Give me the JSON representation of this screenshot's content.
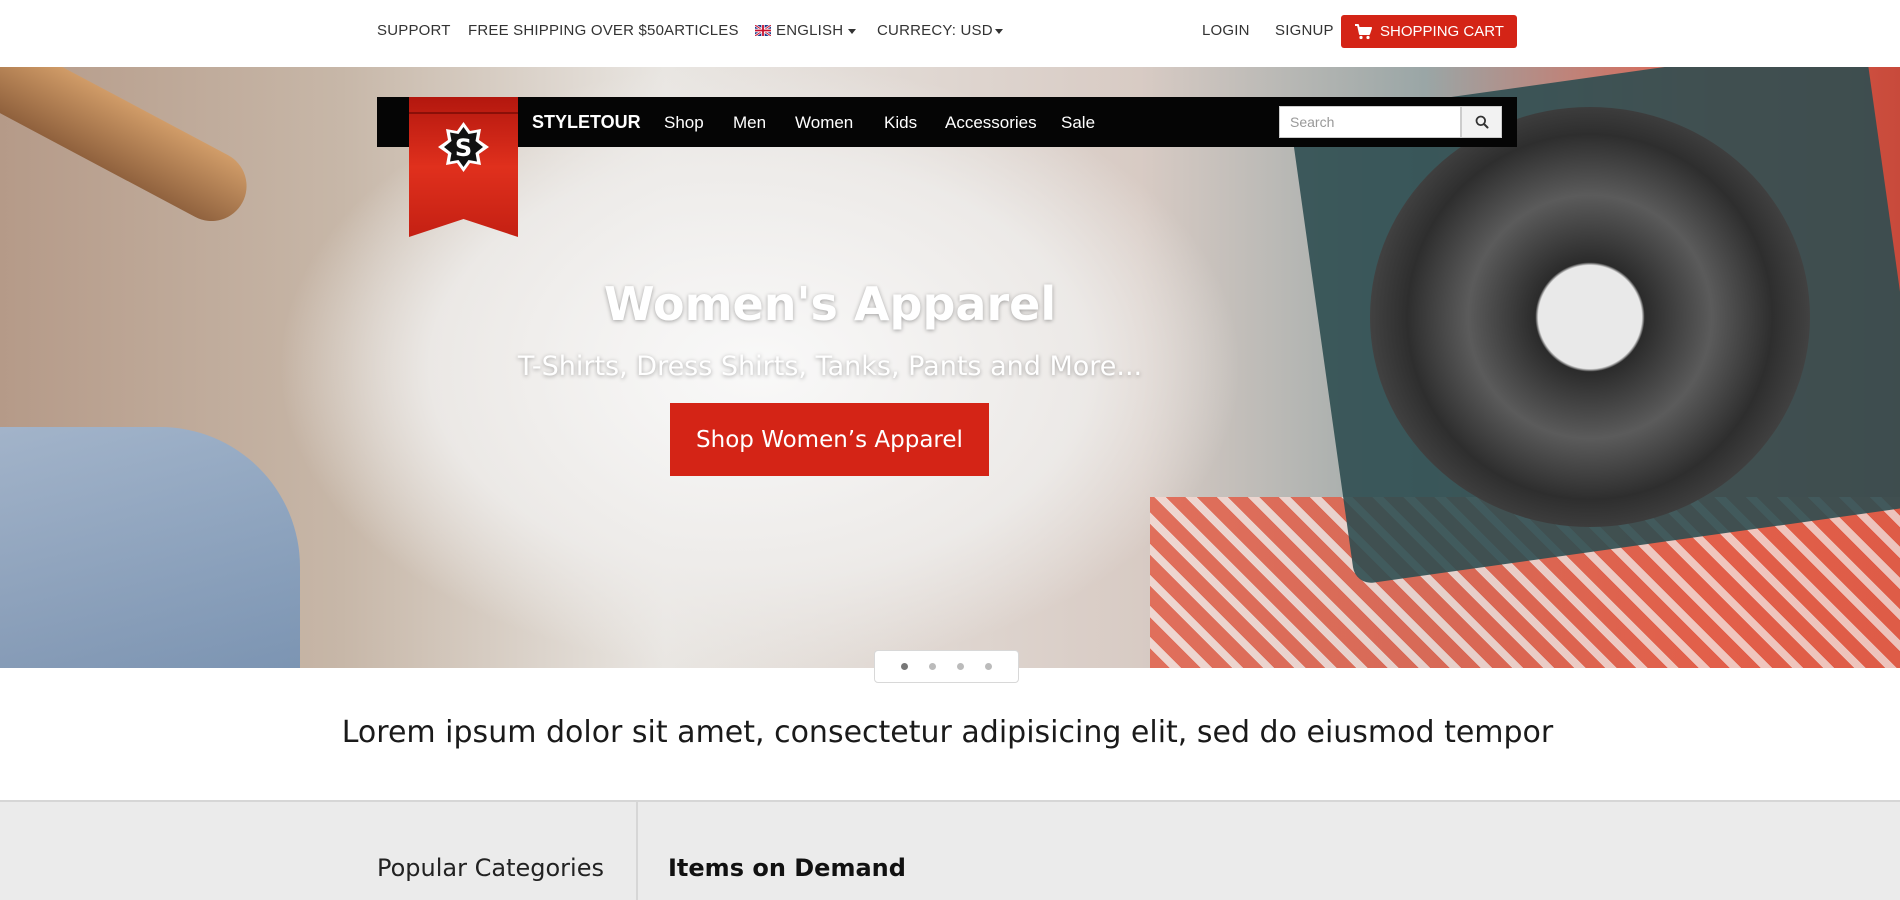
{
  "topbar": {
    "support": "SUPPORT",
    "shipping": "FREE SHIPPING OVER $50",
    "articles": "ARTICLES",
    "language": "ENGLISH",
    "currency": "CURRECY: USD",
    "login": "LOGIN",
    "signup": "SIGNUP",
    "cart": "SHOPPING CART",
    "cart_icon": "cart-icon",
    "flag_icon": "uk-flag-icon"
  },
  "nav": {
    "brand": "STYLETOUR",
    "logo_letter": "S",
    "links": [
      "Shop",
      "Men",
      "Women",
      "Kids",
      "Accessories",
      "Sale"
    ],
    "search_placeholder": "Search",
    "search_icon": "search-icon"
  },
  "hero": {
    "title": "Women's Apparel",
    "subtitle": "T-Shirts, Dress Shirts, Tanks, Pants and More...",
    "cta": "Shop Women’s Apparel",
    "slide_count": 4,
    "active_slide": 1
  },
  "tagline": "Lorem ipsum dolor sit amet, consectetur adipisicing elit, sed do eiusmod tempor",
  "bottom": {
    "popular_categories": "Popular Categories",
    "items_on_demand": "Items on Demand"
  },
  "colors": {
    "accent": "#d42416",
    "navbar": "#050505"
  }
}
